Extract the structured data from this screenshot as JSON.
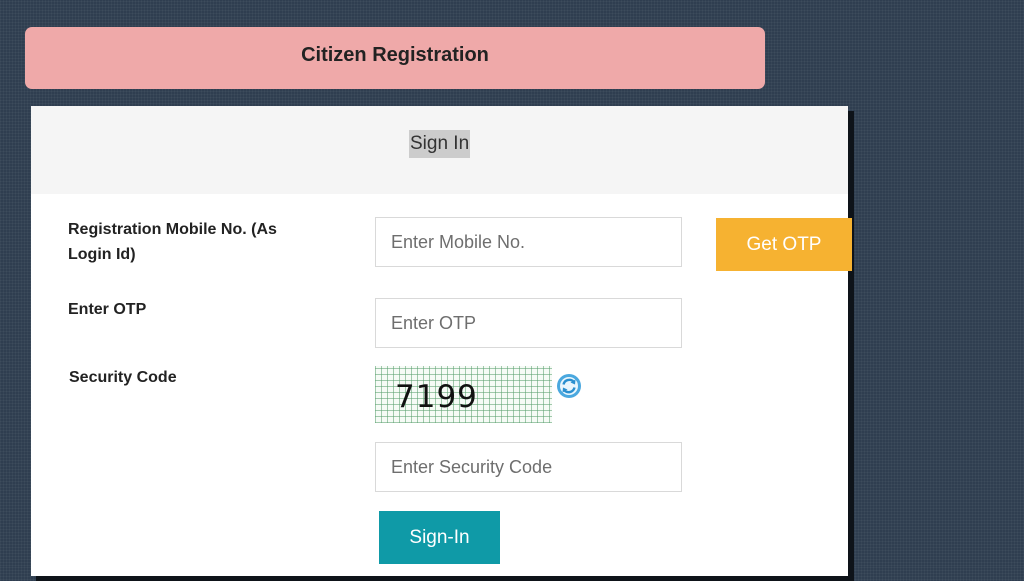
{
  "banner": {
    "title": "Citizen Registration"
  },
  "panel": {
    "tab_label": "Sign In"
  },
  "form": {
    "mobile_label": "Registration Mobile No. (As Login Id)",
    "mobile_placeholder": "Enter Mobile No.",
    "get_otp_label": "Get OTP",
    "otp_label": "Enter OTP",
    "otp_placeholder": "Enter OTP",
    "security_label": "Security Code",
    "captcha_value": "7199",
    "refresh_icon": "refresh-icon",
    "security_placeholder": "Enter Security Code",
    "signin_label": "Sign-In"
  },
  "colors": {
    "banner_bg": "#efa9a9",
    "otp_button": "#f6b231",
    "signin_button": "#0f9aa7",
    "background": "#2f3e50"
  }
}
